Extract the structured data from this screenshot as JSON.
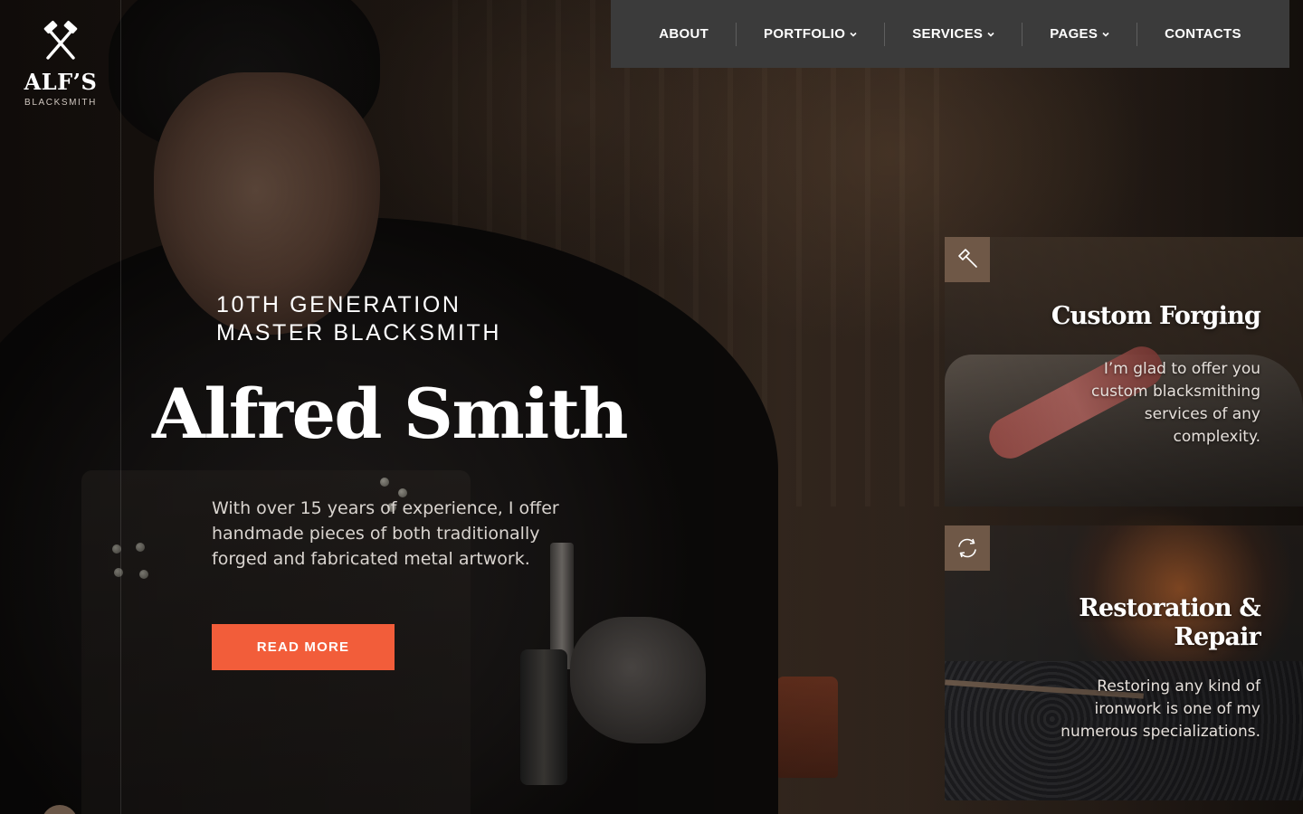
{
  "brand": {
    "name": "ALF’S",
    "tagline": "BLACKSMITH",
    "icon": "crossed-hammers-icon"
  },
  "nav": {
    "items": [
      {
        "label": "ABOUT",
        "has_dropdown": false
      },
      {
        "label": "PORTFOLIO",
        "has_dropdown": true
      },
      {
        "label": "SERVICES",
        "has_dropdown": true
      },
      {
        "label": "PAGES",
        "has_dropdown": true
      },
      {
        "label": "CONTACTS",
        "has_dropdown": false
      }
    ]
  },
  "hero": {
    "kicker_line1": "10TH GENERATION",
    "kicker_line2": "MASTER BLACKSMITH",
    "title": "Alfred Smith",
    "description": "With over 15 years of experience, I offer handmade pieces of both traditionally forged and fabricated metal artwork.",
    "cta_label": "READ MORE"
  },
  "services": [
    {
      "icon": "hammer-icon",
      "title": "Custom Forging",
      "text": "I’m glad to offer you custom blacksmithing services of any complexity."
    },
    {
      "icon": "refresh-icon",
      "title": "Restoration & Repair",
      "text": "Restoring any kind of ironwork is one of my numerous specializations."
    }
  ],
  "colors": {
    "accent": "#f25d3a",
    "nav_bg": "#3b3b3b",
    "icon_box": "#6f5847",
    "text": "#ffffff"
  }
}
